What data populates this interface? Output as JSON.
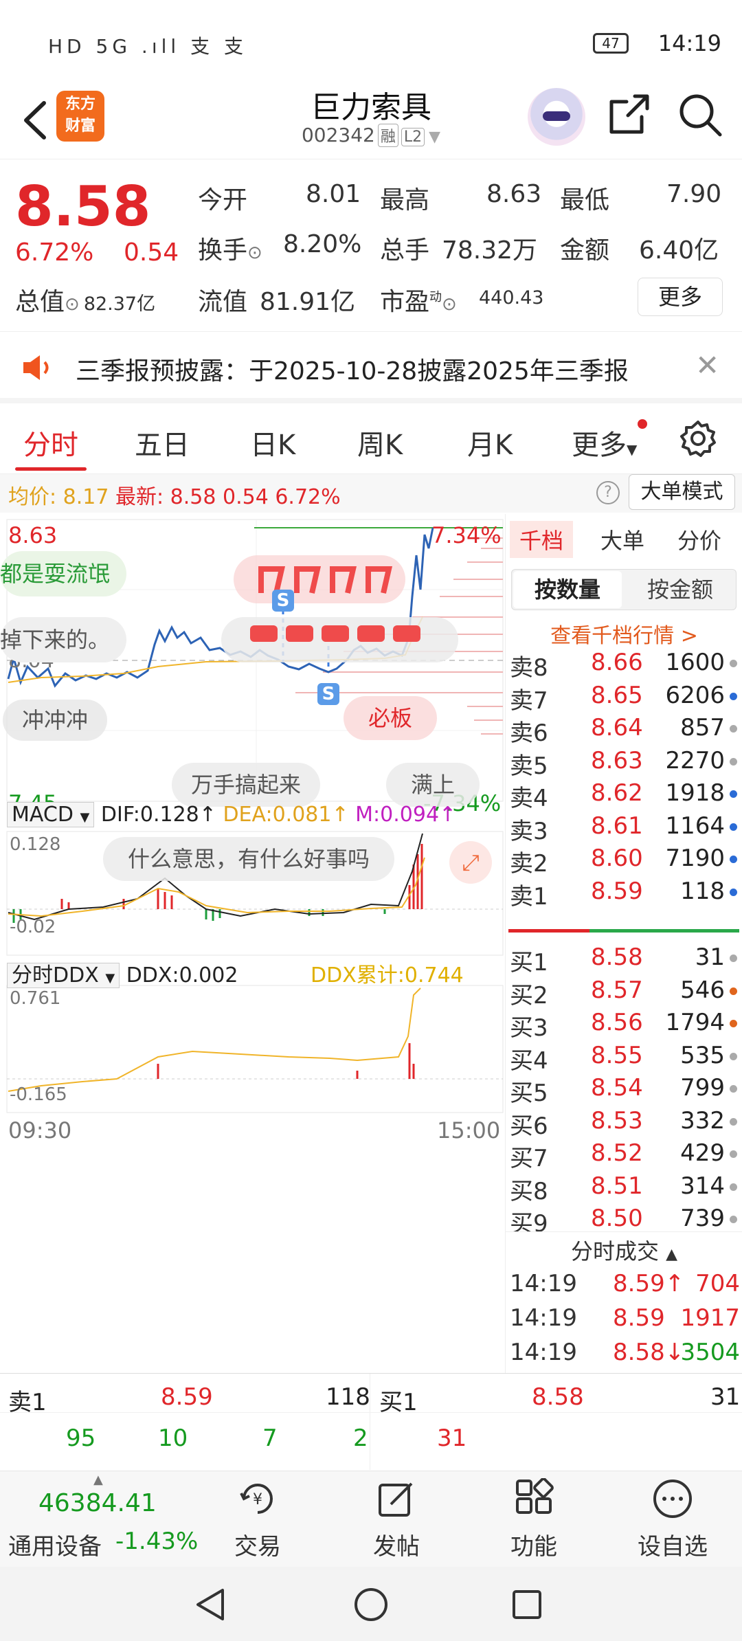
{
  "status": {
    "left_icons": "HD 5G .ıll 支 支",
    "battery": "47",
    "time": "14:19"
  },
  "header": {
    "logo_line1": "东方",
    "logo_line2": "财富",
    "title": "巨力索具",
    "code": "002342",
    "tag1": "融",
    "tag2": "L2"
  },
  "quote": {
    "price": "8.58",
    "change_pct": "6.72%",
    "change_abs": "0.54",
    "open_label": "今开",
    "open": "8.01",
    "high_label": "最高",
    "high": "8.63",
    "low_label": "最低",
    "low": "7.90",
    "turnover_label": "换手",
    "turnover": "8.20%",
    "volume_label": "总手",
    "volume": "78.32万",
    "amount_label": "金额",
    "amount": "6.40亿",
    "mktcap_label": "总值",
    "mktcap": "82.37亿",
    "float_label": "流值",
    "float": "81.91亿",
    "pe_label": "市盈",
    "pe_sup": "动",
    "pe": "440.43",
    "more": "更多"
  },
  "notice": {
    "text": "三季报预披露：于2025-10-28披露2025年三季报"
  },
  "tabs": [
    "分时",
    "五日",
    "日K",
    "周K",
    "月K",
    "更多"
  ],
  "infoline": {
    "avg_label": "均价:",
    "avg": "8.17",
    "last_label": "最新:",
    "last": "8.58",
    "chg": "0.54",
    "pct": "6.72%",
    "mode": "大单模式"
  },
  "intraday": {
    "y_top": "8.63",
    "y_top_pct": "7.34%",
    "y_bottom": "7.45",
    "y_bottom_pct": "-7.34%",
    "prev_close": "8.04",
    "time_start": "09:30",
    "time_end": "15:00",
    "bullets": [
      "都是耍流氓",
      "掉下来的。",
      "冲冲冲",
      "万手搞起来",
      "满上",
      "什么意思，有什么好事吗",
      "必板"
    ],
    "marker_s": "S"
  },
  "macd": {
    "name": "MACD",
    "dif": "DIF:0.128↑",
    "dea": "DEA:0.081↑",
    "m": "M:0.094↑",
    "top": "0.128",
    "bottom": "-0.02"
  },
  "ddx": {
    "name": "分时DDX",
    "ddx": "DDX:0.002",
    "cum": "DDX累计:0.744",
    "top": "0.761",
    "bottom": "-0.165"
  },
  "right": {
    "tabs": [
      "千档",
      "大单",
      "分价"
    ],
    "seg_on": "按数量",
    "seg_off": "按金额",
    "link": "查看千档行情 >",
    "asks": [
      {
        "n": "卖8",
        "p": "8.66",
        "q": "1600",
        "dot": "gray"
      },
      {
        "n": "卖7",
        "p": "8.65",
        "q": "6206",
        "dot": "blue"
      },
      {
        "n": "卖6",
        "p": "8.64",
        "q": "857",
        "dot": "gray"
      },
      {
        "n": "卖5",
        "p": "8.63",
        "q": "2270",
        "dot": "gray"
      },
      {
        "n": "卖4",
        "p": "8.62",
        "q": "1918",
        "dot": "blue"
      },
      {
        "n": "卖3",
        "p": "8.61",
        "q": "1164",
        "dot": "blue"
      },
      {
        "n": "卖2",
        "p": "8.60",
        "q": "7190",
        "dot": "blue"
      },
      {
        "n": "卖1",
        "p": "8.59",
        "q": "118",
        "dot": "blue"
      }
    ],
    "bids": [
      {
        "n": "买1",
        "p": "8.58",
        "q": "31",
        "dot": "gray"
      },
      {
        "n": "买2",
        "p": "8.57",
        "q": "546",
        "dot": "orange"
      },
      {
        "n": "买3",
        "p": "8.56",
        "q": "1794",
        "dot": "orange"
      },
      {
        "n": "买4",
        "p": "8.55",
        "q": "535",
        "dot": "gray"
      },
      {
        "n": "买5",
        "p": "8.54",
        "q": "799",
        "dot": "gray"
      },
      {
        "n": "买6",
        "p": "8.53",
        "q": "332",
        "dot": "gray"
      },
      {
        "n": "买7",
        "p": "8.52",
        "q": "429",
        "dot": "gray"
      },
      {
        "n": "买8",
        "p": "8.51",
        "q": "314",
        "dot": "gray"
      },
      {
        "n": "买9",
        "p": "8.50",
        "q": "739",
        "dot": "gray"
      }
    ],
    "trades_title": "分时成交",
    "trades": [
      {
        "t": "14:19",
        "p": "8.59↑",
        "v": "704",
        "pc": "red",
        "vc": "red"
      },
      {
        "t": "14:19",
        "p": "8.59",
        "v": "1917",
        "pc": "red",
        "vc": "red"
      },
      {
        "t": "14:19",
        "p": "8.58↓",
        "v": "3504",
        "pc": "red",
        "vc": "green"
      }
    ]
  },
  "bottom_quote": {
    "ask_label": "卖1",
    "ask_price": "8.59",
    "ask_qty": "118",
    "bid_label": "买1",
    "bid_price": "8.58",
    "bid_qty": "31",
    "ask_split": [
      "95",
      "10",
      "7",
      "2"
    ],
    "bid_split": [
      "31"
    ]
  },
  "bottombar": {
    "index_value": "46384.41",
    "index_name": "通用设备",
    "index_pct": "-1.43%",
    "items": [
      "交易",
      "发帖",
      "功能",
      "设自选"
    ]
  }
}
